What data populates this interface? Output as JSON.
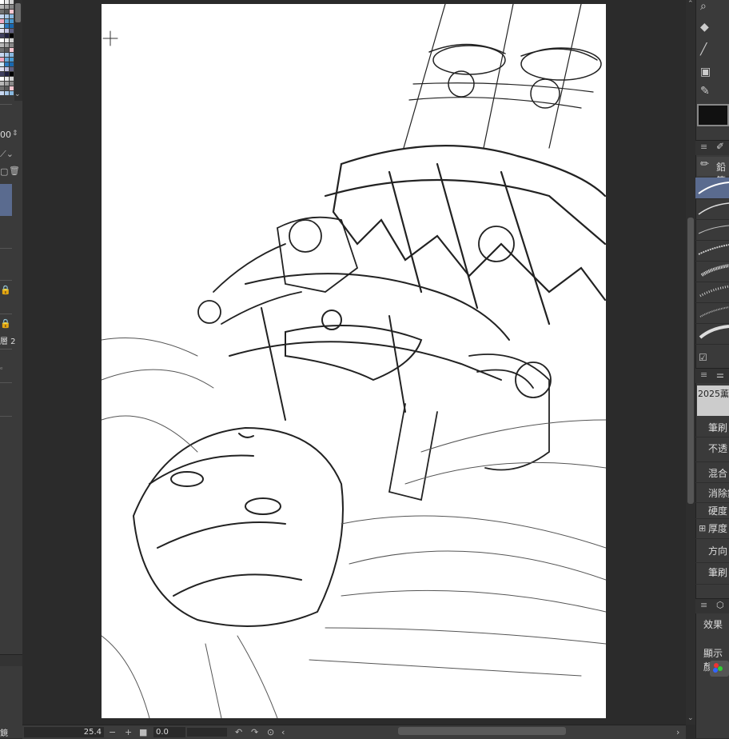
{
  "left_panel": {
    "value_label": "00",
    "layer_label": "層 2",
    "bottom_char": "鏡"
  },
  "bottom_bar": {
    "zoom": "25.4",
    "rotation": "0.0"
  },
  "right_panel": {
    "brush_tab_label": "鉛筆",
    "brush_name": "2025薫",
    "properties": [
      "筆刷",
      "不透",
      "混合",
      "消除鋸",
      "硬度",
      "厚度",
      "方向",
      "筆刷"
    ],
    "effects_label": "效果",
    "display_label": "顯示顏"
  },
  "colors": {
    "background": "#2b2b2b",
    "panel": "#3a3a3a",
    "paper": "#ffffff",
    "selection": "#5a6b8f",
    "main_color": "#111111"
  },
  "icons": [
    "search-icon",
    "fill-icon",
    "line-icon",
    "gradient-icon",
    "pen-icon",
    "brush-icon",
    "undo-icon",
    "redo-icon",
    "reset-rotation-icon"
  ]
}
